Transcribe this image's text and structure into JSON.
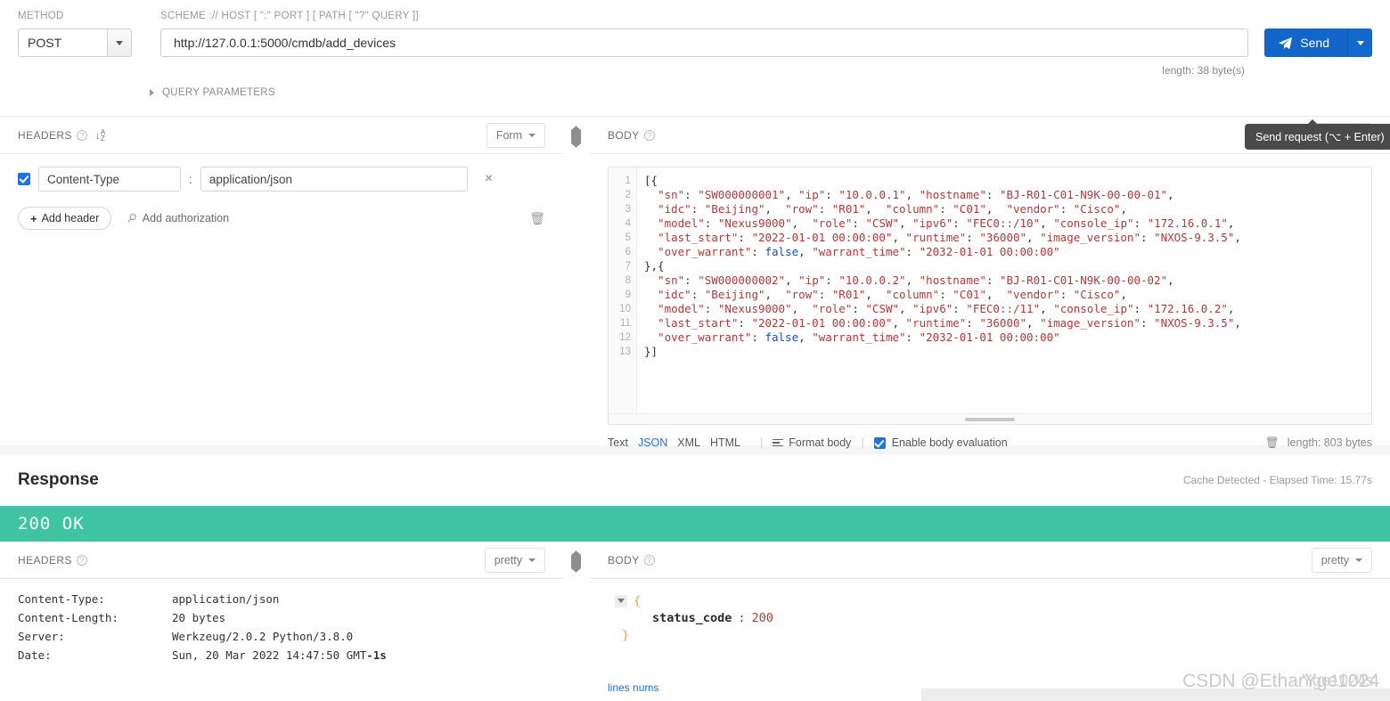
{
  "request": {
    "method_label": "METHOD",
    "method_value": "POST",
    "url_label": "SCHEME :// HOST [ \":\" PORT ] [ PATH [ \"?\" QUERY ]]",
    "url_value": "http://127.0.0.1:5000/cmdb/add_devices",
    "send_label": "Send",
    "send_icon": "paper-plane-icon",
    "url_length": "length: 38 byte(s)",
    "query_parameters_label": "QUERY PARAMETERS",
    "tooltip": "Send request (⌥ + Enter)"
  },
  "headers_panel": {
    "title": "HEADERS",
    "view_mode": "Form",
    "rows": [
      {
        "enabled": true,
        "key": "Content-Type",
        "separator": ":",
        "value": "application/json",
        "remove": "×"
      }
    ],
    "add_header_label": "Add header",
    "add_authorization_label": "Add authorization",
    "delete_all_icon": "trash-icon"
  },
  "body_panel": {
    "title": "BODY",
    "view_mode": "Text",
    "line_numbers": [
      "1",
      "2",
      "3",
      "4",
      "5",
      "6",
      "7",
      "8",
      "9",
      "10",
      "11",
      "12",
      "13"
    ],
    "code_lines": [
      "[{",
      "  \"sn\": \"SW000000001\", \"ip\": \"10.0.0.1\", \"hostname\": \"BJ-R01-C01-N9K-00-00-01\",",
      "  \"idc\": \"Beijing\",  \"row\": \"R01\",  \"column\": \"C01\",  \"vendor\": \"Cisco\",",
      "  \"model\": \"Nexus9000\",  \"role\": \"CSW\", \"ipv6\": \"FEC0::/10\", \"console_ip\": \"172.16.0.1\",",
      "  \"last_start\": \"2022-01-01 00:00:00\", \"runtime\": \"36000\", \"image_version\": \"NXOS-9.3.5\",",
      "  \"over_warrant\": false, \"warrant_time\": \"2032-01-01 00:00:00\"",
      "},{",
      "  \"sn\": \"SW000000002\", \"ip\": \"10.0.0.2\", \"hostname\": \"BJ-R01-C01-N9K-00-00-02\",",
      "  \"idc\": \"Beijing\",  \"row\": \"R01\",  \"column\": \"C01\",  \"vendor\": \"Cisco\",",
      "  \"model\": \"Nexus9000\",  \"role\": \"CSW\", \"ipv6\": \"FEC0::/11\", \"console_ip\": \"172.16.0.2\",",
      "  \"last_start\": \"2022-01-01 00:00:00\", \"runtime\": \"36000\", \"image_version\": \"NXOS-9.3.5\",",
      "  \"over_warrant\": false, \"warrant_time\": \"2032-01-01 00:00:00\"",
      "}]"
    ],
    "formats": [
      "Text",
      "JSON",
      "XML",
      "HTML"
    ],
    "active_format": "JSON",
    "format_body_label": "Format body",
    "enable_body_evaluation_label": "Enable body evaluation",
    "enable_body_evaluation_checked": true,
    "body_length": "length: 803 bytes"
  },
  "response": {
    "title": "Response",
    "meta": "Cache Detected - Elapsed Time: 15.77s",
    "status": "200 OK",
    "status_color": "#3ec4a3",
    "headers_panel": {
      "title": "HEADERS",
      "view_mode": "pretty",
      "rows": [
        {
          "key": "Content-Type:",
          "value": "application/json",
          "suffix": ""
        },
        {
          "key": "Content-Length:",
          "value": "20 bytes",
          "suffix": ""
        },
        {
          "key": "Server:",
          "value": "Werkzeug/2.0.2 Python/3.8.0",
          "suffix": ""
        },
        {
          "key": "Date:",
          "value": "Sun, 20 Mar 2022 14:47:50 GMT",
          "suffix": "-1s"
        }
      ]
    },
    "body_panel": {
      "title": "BODY",
      "view_mode": "pretty",
      "open_brace": "{",
      "key": "status_code",
      "separator": ":",
      "value": "200",
      "close_brace": "}",
      "lines_nums_label": "lines nums"
    }
  },
  "watermarks": {
    "primary": "CSDN @EtharYge1024",
    "secondary": "Yge1024s"
  },
  "colors": {
    "accent_blue": "#1266c9",
    "success_green": "#3ec4a3",
    "link_blue": "#1a73e8",
    "code_string": "#b5393a",
    "code_keyword": "#1f49c6"
  }
}
